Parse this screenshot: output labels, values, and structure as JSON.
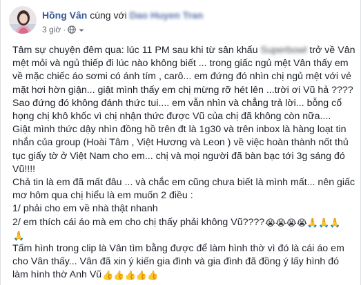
{
  "post": {
    "author": "Hồng Vân",
    "with_word": "cùng với",
    "tagged_user": "Dao Huyen Tran",
    "time": "3 giờ",
    "dot": "·",
    "privacy_icon": "globe-icon",
    "menu_icon": "chevron-down-icon"
  },
  "content": {
    "p1": {
      "l1a": "Tâm sự chuyện đêm qua: lúc 11 PM sau khi từ sân khấu ",
      "l1_blur": "Superbowl",
      "l1b": " trở về Vân",
      "l2": "mệt mỏi và ngủ thiếp đi lúc nào không biết ... trong giấc ngủ mệt Vân thấy em",
      "l3": "về mặc chiếc áo sơmi có ánh tím , carô... em đứng đó nhìn chị ngủ mệt với vẻ",
      "l4": "mặt hơi hờn giận... giật mình thấy em chị mừng rỡ hét lên ...trời ơi Vũ hả ????",
      "l5": "Sao đứng đó không đánh thức tui.... em vẫn nhìn và chẳng trả lời... bỗng cổ",
      "l6": "họng chị khô khốc vì chị nhận thức được Vũ của chị đã không còn nữa...."
    },
    "p2": {
      "l1": "Giật mình thức dậy nhìn đồng hồ trên đt là 1g30 và trên inbox là hàng loạt tin",
      "l2": "nhắn của group (Hoài Tâm , Việt Hương và Leon ) về việc hoàn thành nốt thủ",
      "l3": "tục giấy tờ ở Việt Nam cho em... chị và mọi người đã bàn bạc tới 3g sáng đó",
      "l4": "Vũ!!!!"
    },
    "p3": {
      "l1": "Chả tin là em đã mất đâu ... và chắc em cũng chưa biết là mình mất... nên giấc",
      "l2": "mơ hôm qua chị hiểu là em muốn 2 điều :",
      "l3": "1/ phải cho em về nhà thật nhanh",
      "l4": "2/ em thích cái áo mà em cho chị thấy phải không Vũ????",
      "l4_emoji": "😭😭😭😭🙏🙏🙏",
      "l5_emoji": "🙏"
    },
    "p4": {
      "l1": "Tấm hình trong clip là Vân tìm bằng được để làm hình thờ vì đó là cái áo em",
      "l2": "cho Vân thấy... Vân đã xin ý kiến gia đình và gia đình đã đồng ý lấy hình đó",
      "l3": "làm hình thờ Anh Vũ",
      "l3_emoji": "👍👍👍👍👍"
    }
  }
}
